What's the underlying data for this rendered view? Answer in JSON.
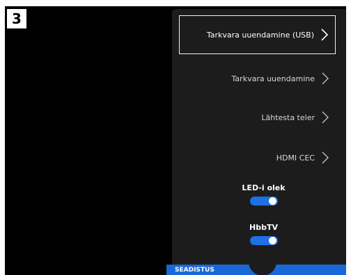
{
  "step_number": "3",
  "menu": {
    "items": [
      {
        "label": "Tarkvara uuendamine (USB)",
        "selected": true
      },
      {
        "label": "Tarkvara uuendamine",
        "selected": false
      },
      {
        "label": "Lähtesta teler",
        "selected": false
      },
      {
        "label": "HDMI CEC",
        "selected": false
      }
    ],
    "toggles": [
      {
        "label": "LED-i olek",
        "on": true
      },
      {
        "label": "HbbTV",
        "on": true
      }
    ]
  },
  "footer": {
    "section_title": "SEADISTUS"
  },
  "colors": {
    "background": "#000000",
    "panel": "#1c1c1c",
    "toggle_on": "#1f6fe5",
    "footer_bar": "#1a68d8"
  },
  "icons": {
    "chevron": "chevron-right-icon"
  }
}
